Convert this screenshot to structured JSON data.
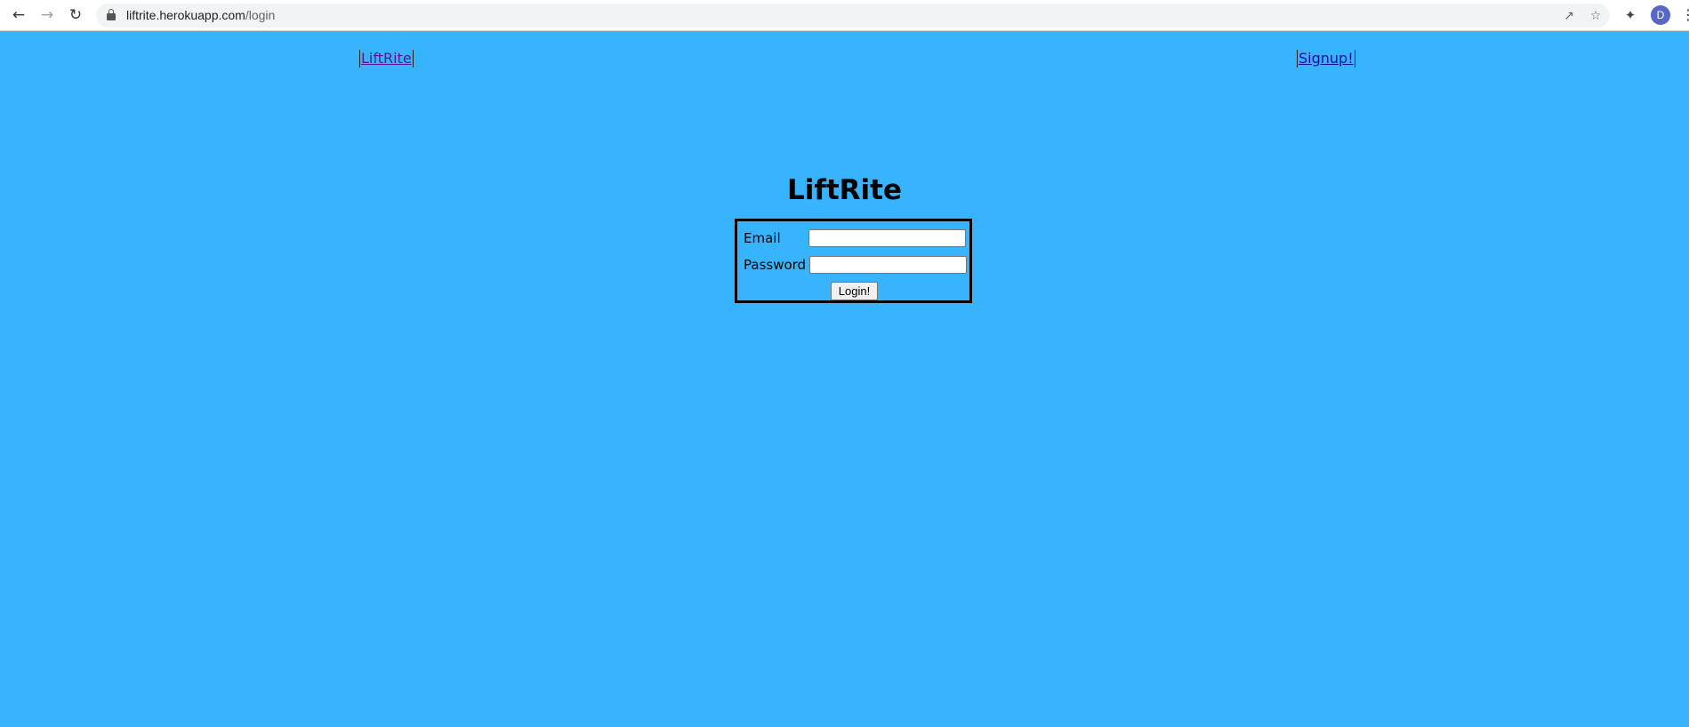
{
  "browser": {
    "url_host": "liftrite.herokuapp.com",
    "url_path": "/login",
    "profile_initial": "D",
    "icons": [
      "back-icon",
      "forward-icon",
      "reload-icon",
      "lock-icon",
      "share-icon",
      "star-icon",
      "extensions-icon",
      "menu-icon"
    ]
  },
  "nav": {
    "brand_link": "LiftRite",
    "signup_link": "Signup!"
  },
  "main": {
    "title": "LiftRite",
    "form": {
      "email_label": "Email",
      "email_value": "",
      "password_label": "Password",
      "password_value": "",
      "submit_label": "Login!"
    }
  },
  "colors": {
    "page_background": "#38b4fe",
    "form_border": "#000000"
  }
}
